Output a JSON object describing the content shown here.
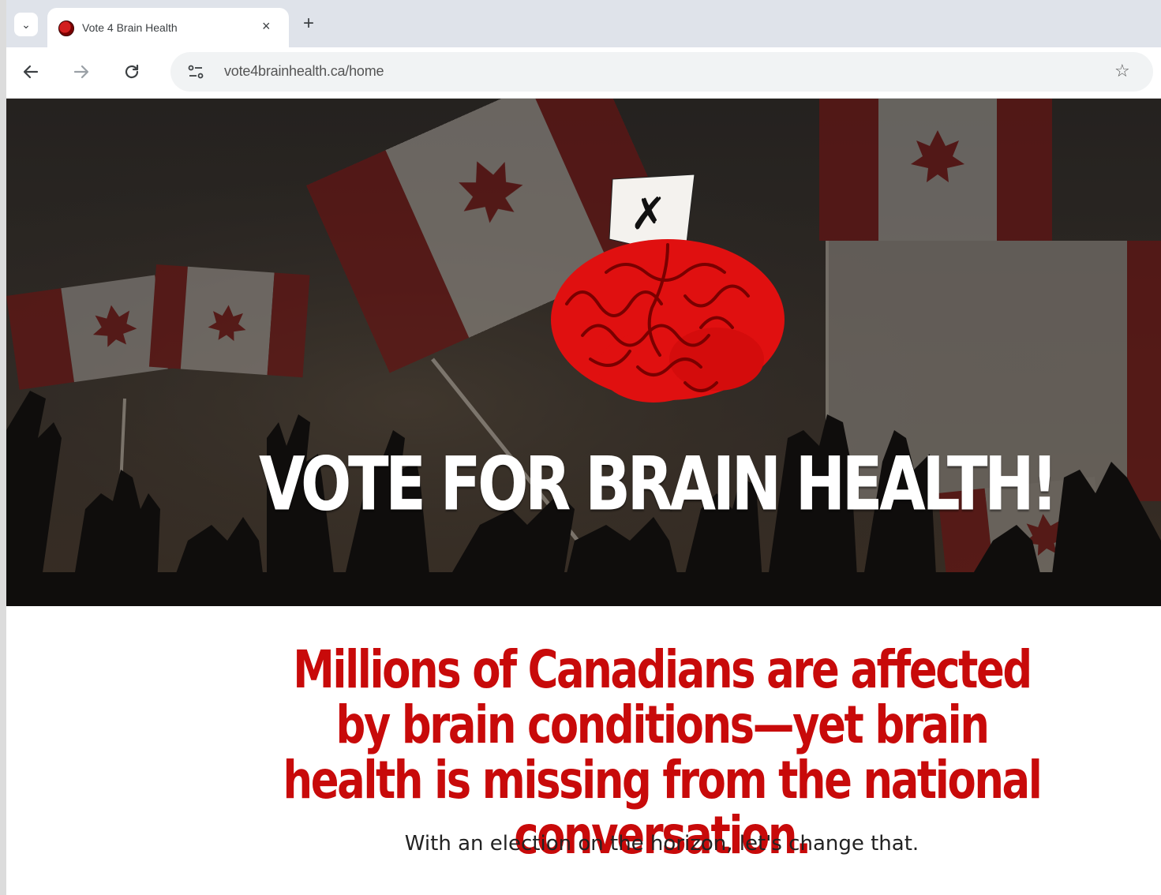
{
  "browser": {
    "tab": {
      "title": "Vote 4 Brain Health",
      "close_glyph": "×"
    },
    "new_tab_glyph": "+",
    "tab_search_icon": "chevron-down-icon",
    "address_bar": {
      "url": "vote4brainhealth.ca/home"
    },
    "toolbar_icons": [
      "back-arrow-icon",
      "forward-arrow-icon",
      "reload-icon",
      "site-info-icon",
      "bookmark-star-icon"
    ]
  },
  "hero": {
    "title": "VOTE FOR BRAIN HEALTH!",
    "ballot_mark": "✗",
    "colors": {
      "brain": "#e01010",
      "background": "#2e2824",
      "title": "#ffffff"
    }
  },
  "main": {
    "headline": "Millions of Canadians are affected by brain conditions—yet brain health is missing from the national conversation.",
    "subline": "With an election on the horizon, let's change that.",
    "colors": {
      "headline": "#c80a0a"
    }
  }
}
